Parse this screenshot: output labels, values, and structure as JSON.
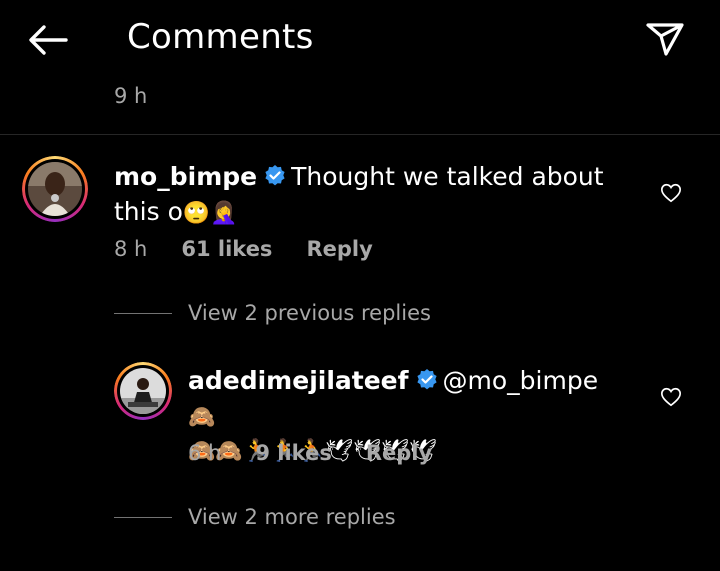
{
  "header": {
    "title": "Comments"
  },
  "previous": {
    "time": "9 h"
  },
  "comment": {
    "username": "mo_bimpe",
    "text_line1": "Thought we talked about",
    "text_line2": "this o",
    "emojis": "🙄🤦‍♀️",
    "time": "8 h",
    "likes": "61 likes",
    "reply_label": "Reply"
  },
  "view_previous": "View 2 previous replies",
  "reply": {
    "username": "adedimejilateef",
    "mention": "@mo_bimpe",
    "emoji_line1": "🙈",
    "emoji_line2": "🙈🙈🏃🏃🏃🕊🕊🕊🕊",
    "time": "6 h",
    "likes": "9 likes",
    "reply_label": "Reply"
  },
  "view_more": "View 2 more replies",
  "colors": {
    "background": "#000000",
    "secondary_text": "#a8a8a8",
    "verified": "#3897f0"
  }
}
